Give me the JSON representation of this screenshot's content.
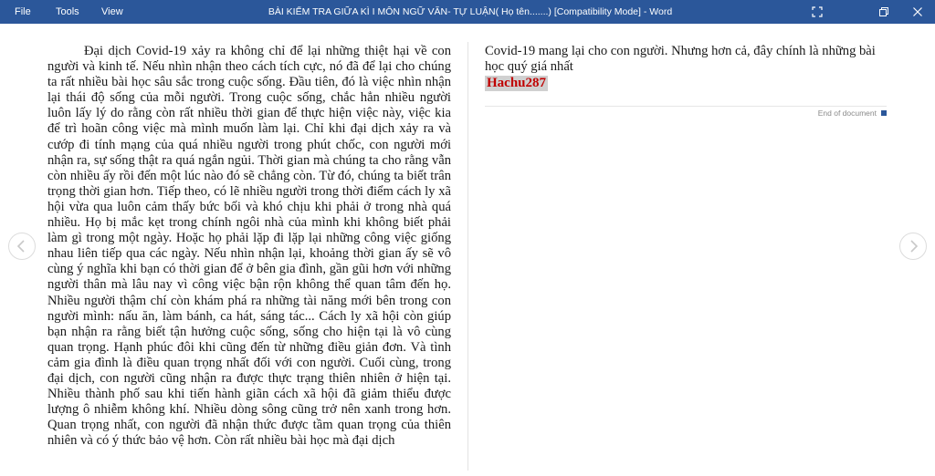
{
  "menu": {
    "file": "File",
    "tools": "Tools",
    "view": "View"
  },
  "window": {
    "title": "BÀI KIỂM TRA GIỮA KÌ I MÔN NGỮ VĂN- TỰ LUẬN( Họ tên.......) [Compatibility Mode]  -  Word",
    "accent": "#2b579a"
  },
  "document": {
    "left_text": "Đại dịch Covid-19 xảy ra không chỉ để lại những thiệt hại về con người và kinh tế. Nếu nhìn nhận theo cách tích cực, nó đã để lại cho chúng ta rất nhiều bài học sâu sắc trong cuộc sống. Đầu tiên, đó là việc nhìn nhận lại thái độ sống của mỗi người. Trong cuộc sống, chắc hẳn nhiều người luôn lấy lý do rằng còn rất nhiều thời gian để thực hiện việc này, việc kia để trì hoãn công việc mà mình muốn làm lại. Chỉ khi đại dịch xảy ra và cướp đi tính mạng của quá nhiều người trong phút chốc, con người mới nhận ra, sự sống thật ra quá ngắn ngủi. Thời gian mà chúng ta cho rằng vẫn còn nhiều ấy rồi đến một lúc nào đó sẽ chẳng còn. Từ đó, chúng ta biết trân trọng thời gian hơn. Tiếp theo, có lẽ nhiều người trong thời điểm cách ly xã hội vừa qua luôn cảm thấy bức bối và khó chịu khi phải ở trong nhà quá nhiều. Họ bị mắc kẹt trong chính ngôi nhà của mình khi không biết phải làm gì trong một ngày. Hoặc họ phải lặp đi lặp lại những công việc giống nhau liên tiếp qua các ngày. Nếu nhìn nhận lại, khoảng thời gian ấy sẽ vô cùng ý nghĩa khi bạn có thời gian để ở bên gia đình, gần gũi hơn với những người thân mà lâu nay vì công việc bận rộn không thể quan tâm đến họ. Nhiều người thậm chí còn khám phá ra những tài năng mới bên trong con người mình: nấu ăn, làm bánh, ca hát, sáng tác... Cách ly xã hội còn giúp bạn nhận ra rằng biết tận hưởng cuộc sống, sống cho hiện tại là vô cùng quan trọng. Hạnh phúc đôi khi cũng đến từ những điều giản đơn. Và tình cảm gia đình là điều quan trọng nhất đối với con người. Cuối cùng, trong đại dịch, con người cũng nhận ra được thực trạng thiên nhiên ở hiện tại. Nhiều thành phố sau khi tiến hành giãn cách xã hội đã giảm thiểu được lượng ô nhiễm không khí. Nhiều dòng sông cũng trở nên xanh trong hơn. Quan trọng nhất, con người đã nhận thức được tầm quan trọng của thiên nhiên và có ý thức bảo vệ hơn. Còn rất nhiều bài học mà đại dịch",
    "right_text": "Covid-19 mang lại cho con người. Nhưng hơn cả, đây chính là những bài học quý giá nhất",
    "author": "Hachu287",
    "end_label": "End of document"
  },
  "icons": {
    "focus": "focus-mode-icon",
    "restore": "restore-window-icon",
    "close": "close-icon",
    "prev": "chevron-left-icon",
    "next": "chevron-right-icon"
  }
}
